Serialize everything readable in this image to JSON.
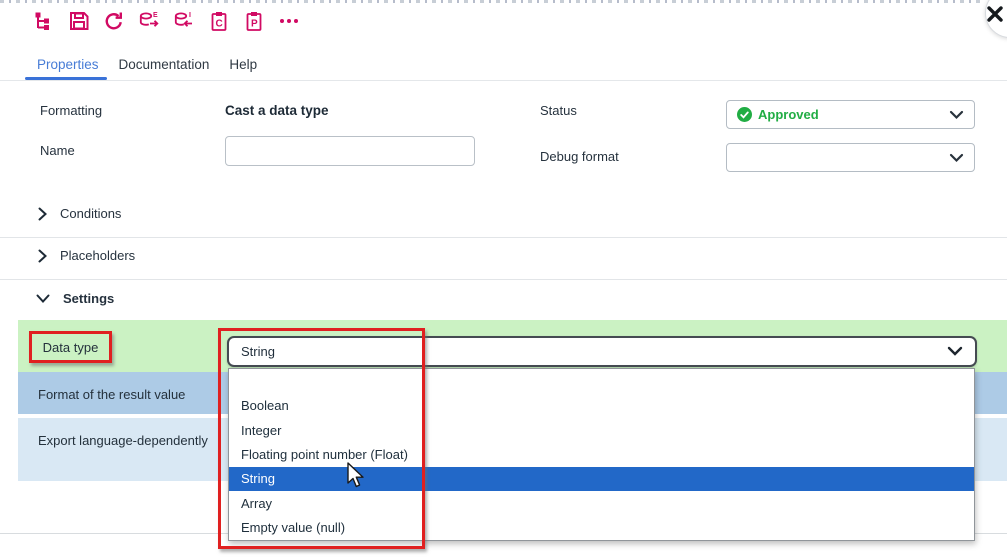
{
  "window": {
    "close_label": "close"
  },
  "toolbar": {
    "icon_names": [
      "tree-structure-icon",
      "save-icon",
      "undo-icon",
      "database-export-icon",
      "database-import-icon",
      "clipboard-copy-icon",
      "clipboard-paste-icon",
      "more-icon"
    ],
    "accent_color": "#d10a63"
  },
  "tabs": [
    {
      "label": "Properties",
      "active": true
    },
    {
      "label": "Documentation",
      "active": false
    },
    {
      "label": "Help",
      "active": false
    }
  ],
  "form": {
    "formatting": {
      "label": "Formatting",
      "value": "Cast a data type"
    },
    "name": {
      "label": "Name",
      "value": ""
    },
    "status": {
      "label": "Status",
      "value": "Approved"
    },
    "debug_format": {
      "label": "Debug format",
      "value": ""
    }
  },
  "sections": {
    "conditions": {
      "label": "Conditions",
      "expanded": false
    },
    "placeholders": {
      "label": "Placeholders",
      "expanded": false
    },
    "settings": {
      "label": "Settings",
      "expanded": true
    }
  },
  "settings": {
    "rows": [
      {
        "label": "Data type"
      },
      {
        "label": "Format of the result value"
      },
      {
        "label": "Export language-dependently"
      }
    ],
    "data_type_select": {
      "value": "String",
      "options": [
        "",
        "Boolean",
        "Integer",
        "Floating point number (Float)",
        "String",
        "Array",
        "Empty value (null)"
      ],
      "selected_index": 4
    }
  },
  "colors": {
    "accent_pink": "#d10a63",
    "tab_active_blue": "#477cd6",
    "approved_green": "#21ad44",
    "row_green": "#cbf2c3",
    "row_blue": "#adcbe6",
    "row_light_blue": "#d9e8f4",
    "selection_blue": "#2268c8",
    "annotation_red": "#e02020"
  }
}
